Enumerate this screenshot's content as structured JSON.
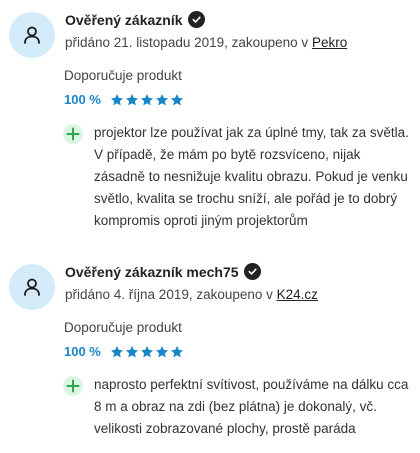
{
  "colors": {
    "accent": "#1b86c7",
    "star": "#1b86c7",
    "avatar_bg": "#d4ecfa",
    "pro_icon_bg": "#dcf5e2",
    "pro_icon": "#2ea84e"
  },
  "reviews": [
    {
      "author": "Ověřený zákazník",
      "meta_prefix": "přidáno 21. listopadu 2019, zakoupeno v ",
      "shop": "Pekro",
      "recommend": "Doporučuje produkt",
      "rating_percent": "100 %",
      "stars": 5,
      "pro": "projektor lze používat jak za úplné tmy, tak za světla. V případě, že mám po bytě rozsvíceno, nijak zásadně to nesnižuje kvalitu obrazu. Pokud je venku světlo, kvalita se trochu sníží, ale pořád je to dobrý kompromis oproti jiným projektorům"
    },
    {
      "author": "Ověřený zákazník mech75",
      "meta_prefix": "přidáno 4. října 2019, zakoupeno v ",
      "shop": "K24.cz",
      "recommend": "Doporučuje produkt",
      "rating_percent": "100 %",
      "stars": 5,
      "pro": "naprosto perfektní svítivost, používáme na dálku cca 8 m a obraz na zdi (bez plátna) je dokonalý, vč. velikosti zobrazované plochy, prostě paráda"
    }
  ],
  "icons": {
    "avatar": "user-icon",
    "verified": "verified-check-icon",
    "star": "star-icon",
    "pro": "plus-icon"
  }
}
